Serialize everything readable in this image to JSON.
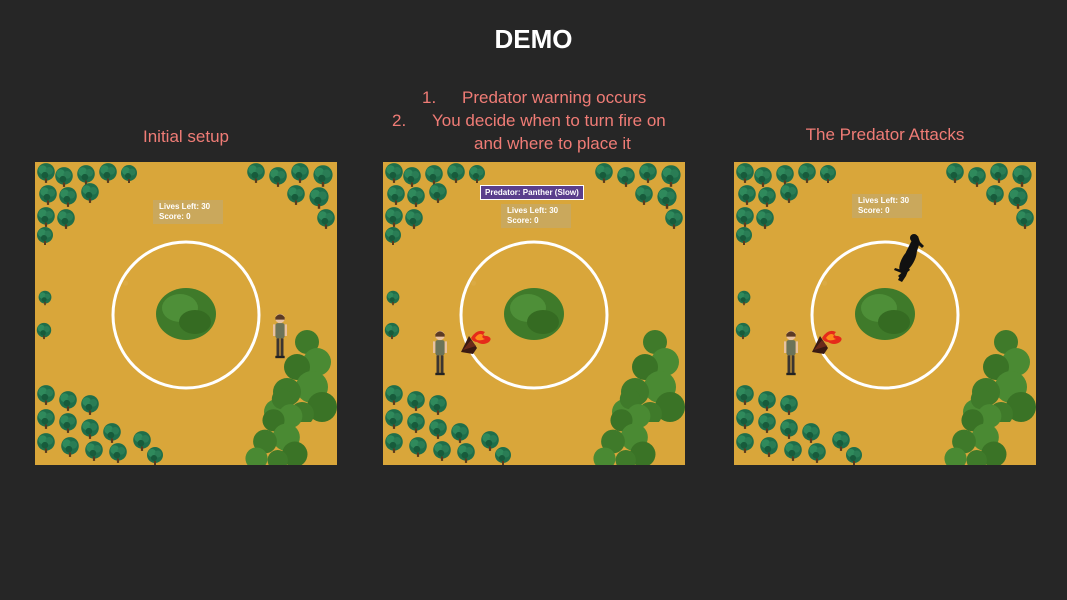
{
  "title": "DEMO",
  "panels": [
    {
      "caption": "Initial setup",
      "hud": {
        "lives": "Lives Left: 30",
        "score": "Score: 0"
      }
    },
    {
      "steps": [
        {
          "num": "1.",
          "text": "Predator warning occurs"
        },
        {
          "num": "2.",
          "text": "You decide when to turn fire on"
        },
        {
          "num": "",
          "text": "and where to place it"
        }
      ],
      "warning": "Predator: Panther (Slow)",
      "hud": {
        "lives": "Lives Left: 30",
        "score": "Score: 0"
      }
    },
    {
      "caption": "The Predator Attacks",
      "hud": {
        "lives": "Lives Left: 30",
        "score": "Score: 0"
      }
    }
  ],
  "colors": {
    "background": "#262626",
    "caption": "#f07c76",
    "ground": "#d9a63a",
    "warning_bg": "#5a3e8c"
  },
  "icons": [
    "tree-cluster-icon",
    "bush-icon",
    "boundary-ring-icon",
    "player-character-icon",
    "fire-icon",
    "panther-icon"
  ]
}
